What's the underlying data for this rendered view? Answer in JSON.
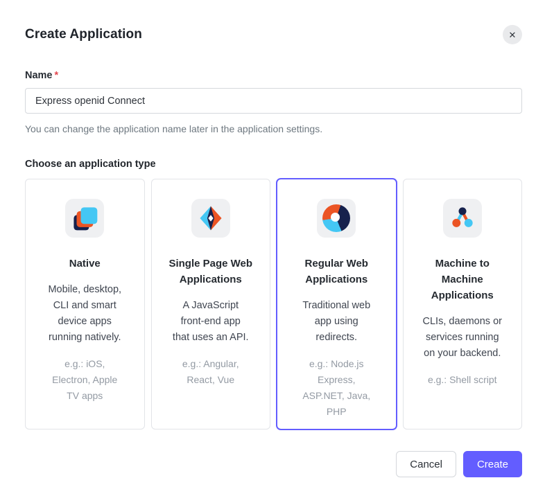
{
  "dialog": {
    "title": "Create Application"
  },
  "icons": {
    "close": "✕"
  },
  "name_field": {
    "label": "Name",
    "required_marker": "*",
    "value": "Express openid Connect",
    "helper": "You can change the application name later in the application settings."
  },
  "type_section": {
    "label": "Choose an application type",
    "cards": [
      {
        "title": "Native",
        "description": "Mobile, desktop,\nCLI and smart\ndevice apps\nrunning natively.",
        "example": "e.g.: iOS,\nElectron, Apple\nTV apps",
        "icon": "stacked-squares-icon",
        "selected": false
      },
      {
        "title": "Single Page Web\nApplications",
        "description": "A JavaScript\nfront-end app\nthat uses an API.",
        "example": "e.g.: Angular,\nReact, Vue",
        "icon": "overlapping-diamonds-icon",
        "selected": false
      },
      {
        "title": "Regular Web\nApplications",
        "description": "Traditional web\napp using\nredirects.",
        "example": "e.g.: Node.js\nExpress,\nASP.NET, Java,\nPHP",
        "icon": "donut-swirl-icon",
        "selected": true
      },
      {
        "title": "Machine to\nMachine\nApplications",
        "description": "CLIs, daemons or\nservices running\non your backend.",
        "example": "e.g.: Shell script",
        "icon": "molecule-icon",
        "selected": false
      }
    ]
  },
  "footer": {
    "cancel_label": "Cancel",
    "create_label": "Create"
  },
  "colors": {
    "accent_purple": "#635DFF",
    "brand_orange": "#EB5424",
    "brand_navy": "#16214D",
    "brand_blue": "#44C7F4",
    "required_red": "#E34850",
    "icon_tile_bg": "#EFF0F2"
  }
}
